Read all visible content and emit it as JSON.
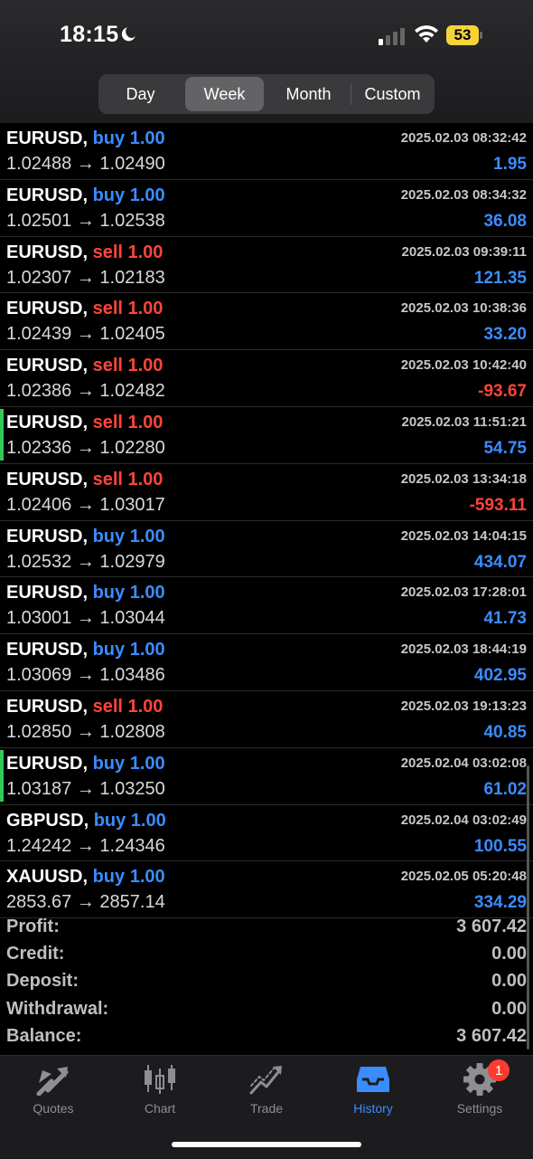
{
  "status": {
    "time": "18:15",
    "battery": "53"
  },
  "periods": [
    {
      "label": "Day",
      "active": false
    },
    {
      "label": "Week",
      "active": true
    },
    {
      "label": "Month",
      "active": false
    },
    {
      "label": "Custom",
      "active": false
    }
  ],
  "deals": [
    {
      "symbol": "EURUSD,",
      "side": "buy 1.00",
      "type": "buy",
      "time": "2025.02.03 08:32:42",
      "prices": "1.02488 → 1.02490",
      "profit": "1.95",
      "positive": true,
      "marked": false
    },
    {
      "symbol": "EURUSD,",
      "side": "buy 1.00",
      "type": "buy",
      "time": "2025.02.03 08:34:32",
      "prices": "1.02501 → 1.02538",
      "profit": "36.08",
      "positive": true,
      "marked": false
    },
    {
      "symbol": "EURUSD,",
      "side": "sell 1.00",
      "type": "sell",
      "time": "2025.02.03 09:39:11",
      "prices": "1.02307 → 1.02183",
      "profit": "121.35",
      "positive": true,
      "marked": false
    },
    {
      "symbol": "EURUSD,",
      "side": "sell 1.00",
      "type": "sell",
      "time": "2025.02.03 10:38:36",
      "prices": "1.02439 → 1.02405",
      "profit": "33.20",
      "positive": true,
      "marked": false
    },
    {
      "symbol": "EURUSD,",
      "side": "sell 1.00",
      "type": "sell",
      "time": "2025.02.03 10:42:40",
      "prices": "1.02386 → 1.02482",
      "profit": "-93.67",
      "positive": false,
      "marked": false
    },
    {
      "symbol": "EURUSD,",
      "side": "sell 1.00",
      "type": "sell",
      "time": "2025.02.03 11:51:21",
      "prices": "1.02336 → 1.02280",
      "profit": "54.75",
      "positive": true,
      "marked": true
    },
    {
      "symbol": "EURUSD,",
      "side": "sell 1.00",
      "type": "sell",
      "time": "2025.02.03 13:34:18",
      "prices": "1.02406 → 1.03017",
      "profit": "-593.11",
      "positive": false,
      "marked": false
    },
    {
      "symbol": "EURUSD,",
      "side": "buy 1.00",
      "type": "buy",
      "time": "2025.02.03 14:04:15",
      "prices": "1.02532 → 1.02979",
      "profit": "434.07",
      "positive": true,
      "marked": false
    },
    {
      "symbol": "EURUSD,",
      "side": "buy 1.00",
      "type": "buy",
      "time": "2025.02.03 17:28:01",
      "prices": "1.03001 → 1.03044",
      "profit": "41.73",
      "positive": true,
      "marked": false
    },
    {
      "symbol": "EURUSD,",
      "side": "buy 1.00",
      "type": "buy",
      "time": "2025.02.03 18:44:19",
      "prices": "1.03069 → 1.03486",
      "profit": "402.95",
      "positive": true,
      "marked": false
    },
    {
      "symbol": "EURUSD,",
      "side": "sell 1.00",
      "type": "sell",
      "time": "2025.02.03 19:13:23",
      "prices": "1.02850 → 1.02808",
      "profit": "40.85",
      "positive": true,
      "marked": false
    },
    {
      "symbol": "EURUSD,",
      "side": "buy 1.00",
      "type": "buy",
      "time": "2025.02.04 03:02:08",
      "prices": "1.03187 → 1.03250",
      "profit": "61.02",
      "positive": true,
      "marked": true
    },
    {
      "symbol": "GBPUSD,",
      "side": "buy 1.00",
      "type": "buy",
      "time": "2025.02.04 03:02:49",
      "prices": "1.24242 → 1.24346",
      "profit": "100.55",
      "positive": true,
      "marked": false
    },
    {
      "symbol": "XAUUSD,",
      "side": "buy 1.00",
      "type": "buy",
      "time": "2025.02.05 05:20:48",
      "prices": "2853.67 → 2857.14",
      "profit": "334.29",
      "positive": true,
      "marked": false
    }
  ],
  "summary": [
    {
      "label": "Profit:",
      "value": "3 607.42"
    },
    {
      "label": "Credit:",
      "value": "0.00"
    },
    {
      "label": "Deposit:",
      "value": "0.00"
    },
    {
      "label": "Withdrawal:",
      "value": "0.00"
    },
    {
      "label": "Balance:",
      "value": "3 607.42"
    }
  ],
  "tabs": [
    {
      "label": "Quotes",
      "icon": "quotes-icon",
      "active": false
    },
    {
      "label": "Chart",
      "icon": "chart-icon",
      "active": false
    },
    {
      "label": "Trade",
      "icon": "trade-icon",
      "active": false
    },
    {
      "label": "History",
      "icon": "history-icon",
      "active": true
    },
    {
      "label": "Settings",
      "icon": "settings-icon",
      "active": false,
      "badge": "1"
    }
  ],
  "colors": {
    "buy": "#3b8cff",
    "sell": "#ff453a",
    "marker": "#34c759",
    "active_tab": "#3b8cff"
  }
}
